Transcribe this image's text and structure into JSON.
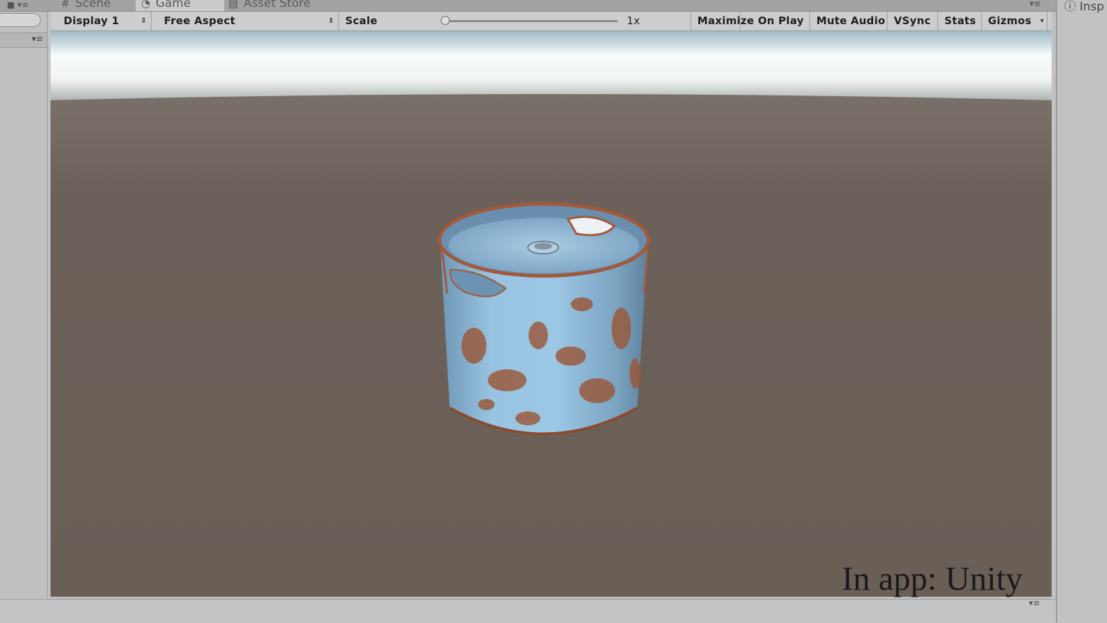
{
  "tabs": [
    {
      "label": "Scene",
      "icon": "hash-icon"
    },
    {
      "label": "Game",
      "icon": "pacman-icon",
      "active": true
    },
    {
      "label": "Asset Store",
      "icon": "store-icon"
    }
  ],
  "inspector_tab": {
    "label": "Insp",
    "icon": "info-icon"
  },
  "toolbar": {
    "display": "Display 1",
    "aspect": "Free Aspect",
    "scale_label": "Scale",
    "scale_value": "1x",
    "scale_slider_fraction": 0.0,
    "maximize": "Maximize On Play",
    "mute": "Mute Audio",
    "vsync": "VSync",
    "stats": "Stats",
    "gizmos": "Gizmos"
  },
  "colors": {
    "sky_top": "#ffffff",
    "sky_horizon": "#b4bcb8",
    "ground": "#6d625b",
    "barrel_paint": "#8db9d8",
    "rust": "#9a5535"
  },
  "watermark": "In app: Unity"
}
